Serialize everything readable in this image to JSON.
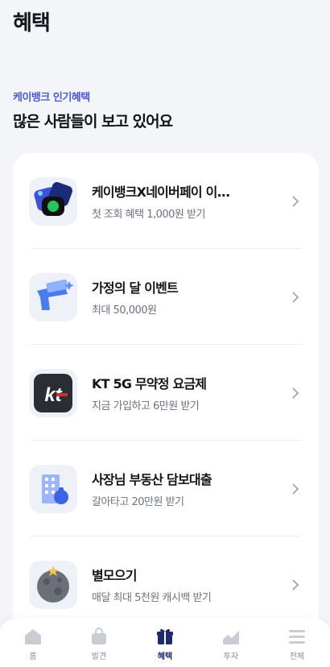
{
  "header": {
    "title": "혜택"
  },
  "section": {
    "eyebrow": "케이뱅크 인기혜택",
    "title": "많은 사람들이 보고 있어요"
  },
  "items": [
    {
      "title": "케이뱅크X네이버페이 이...",
      "subtitle": "첫 조회 혜택 1,000원 받기",
      "icon": "kbank-naverpay-icon"
    },
    {
      "title": "가정의 달 이벤트",
      "subtitle": "최대 50,000원",
      "icon": "money-gun-icon"
    },
    {
      "title": "KT 5G 무약정 요금제",
      "subtitle": "지금 가입하고 6만원 받기",
      "icon": "kt-logo-icon"
    },
    {
      "title": "사장님 부동산 담보대출",
      "subtitle": "갈아타고 20만원 받기",
      "icon": "building-icon"
    },
    {
      "title": "별모으기",
      "subtitle": "매달 최대 5천원 캐시백 받기",
      "icon": "moon-icon"
    }
  ],
  "tabs": [
    {
      "label": "홈",
      "icon": "home-icon"
    },
    {
      "label": "발견",
      "icon": "bag-icon"
    },
    {
      "label": "혜택",
      "icon": "gift-icon",
      "active": true
    },
    {
      "label": "투자",
      "icon": "chart-icon"
    },
    {
      "label": "전체",
      "icon": "menu-icon"
    }
  ],
  "colors": {
    "accent": "#4a5bd8",
    "active_tab": "#1d2b6b",
    "background": "#f4f5f9"
  }
}
